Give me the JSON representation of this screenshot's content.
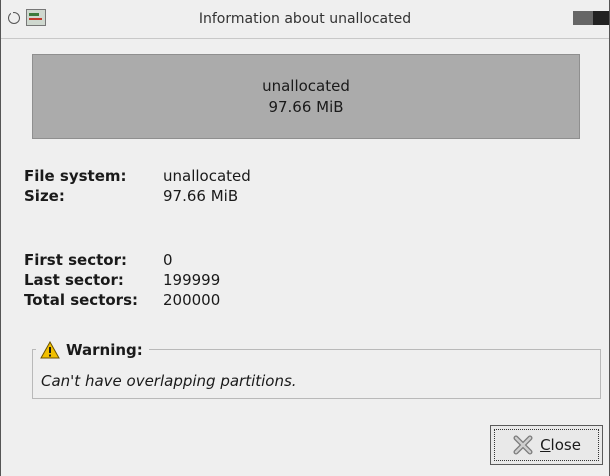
{
  "window": {
    "title": "Information about unallocated"
  },
  "partition_box": {
    "name": "unallocated",
    "size": "97.66 MiB"
  },
  "details": [
    {
      "label": "File system:",
      "value": "unallocated"
    },
    {
      "label": "Size:",
      "value": "97.66 MiB"
    },
    {
      "label": "First sector:",
      "value": "0"
    },
    {
      "label": "Last sector:",
      "value": "199999"
    },
    {
      "label": "Total sectors:",
      "value": "200000"
    }
  ],
  "warning": {
    "title": "Warning:",
    "icon": "warning-triangle-icon",
    "message": "Can't have overlapping partitions."
  },
  "buttons": {
    "close_label": "Close",
    "close_mnemonic": "C",
    "close_rest": "lose",
    "close_icon": "close-x-icon"
  },
  "colors": {
    "partition_fill": "#ababab",
    "window_bg": "#efefef",
    "warning_yellow": "#f2c000"
  }
}
